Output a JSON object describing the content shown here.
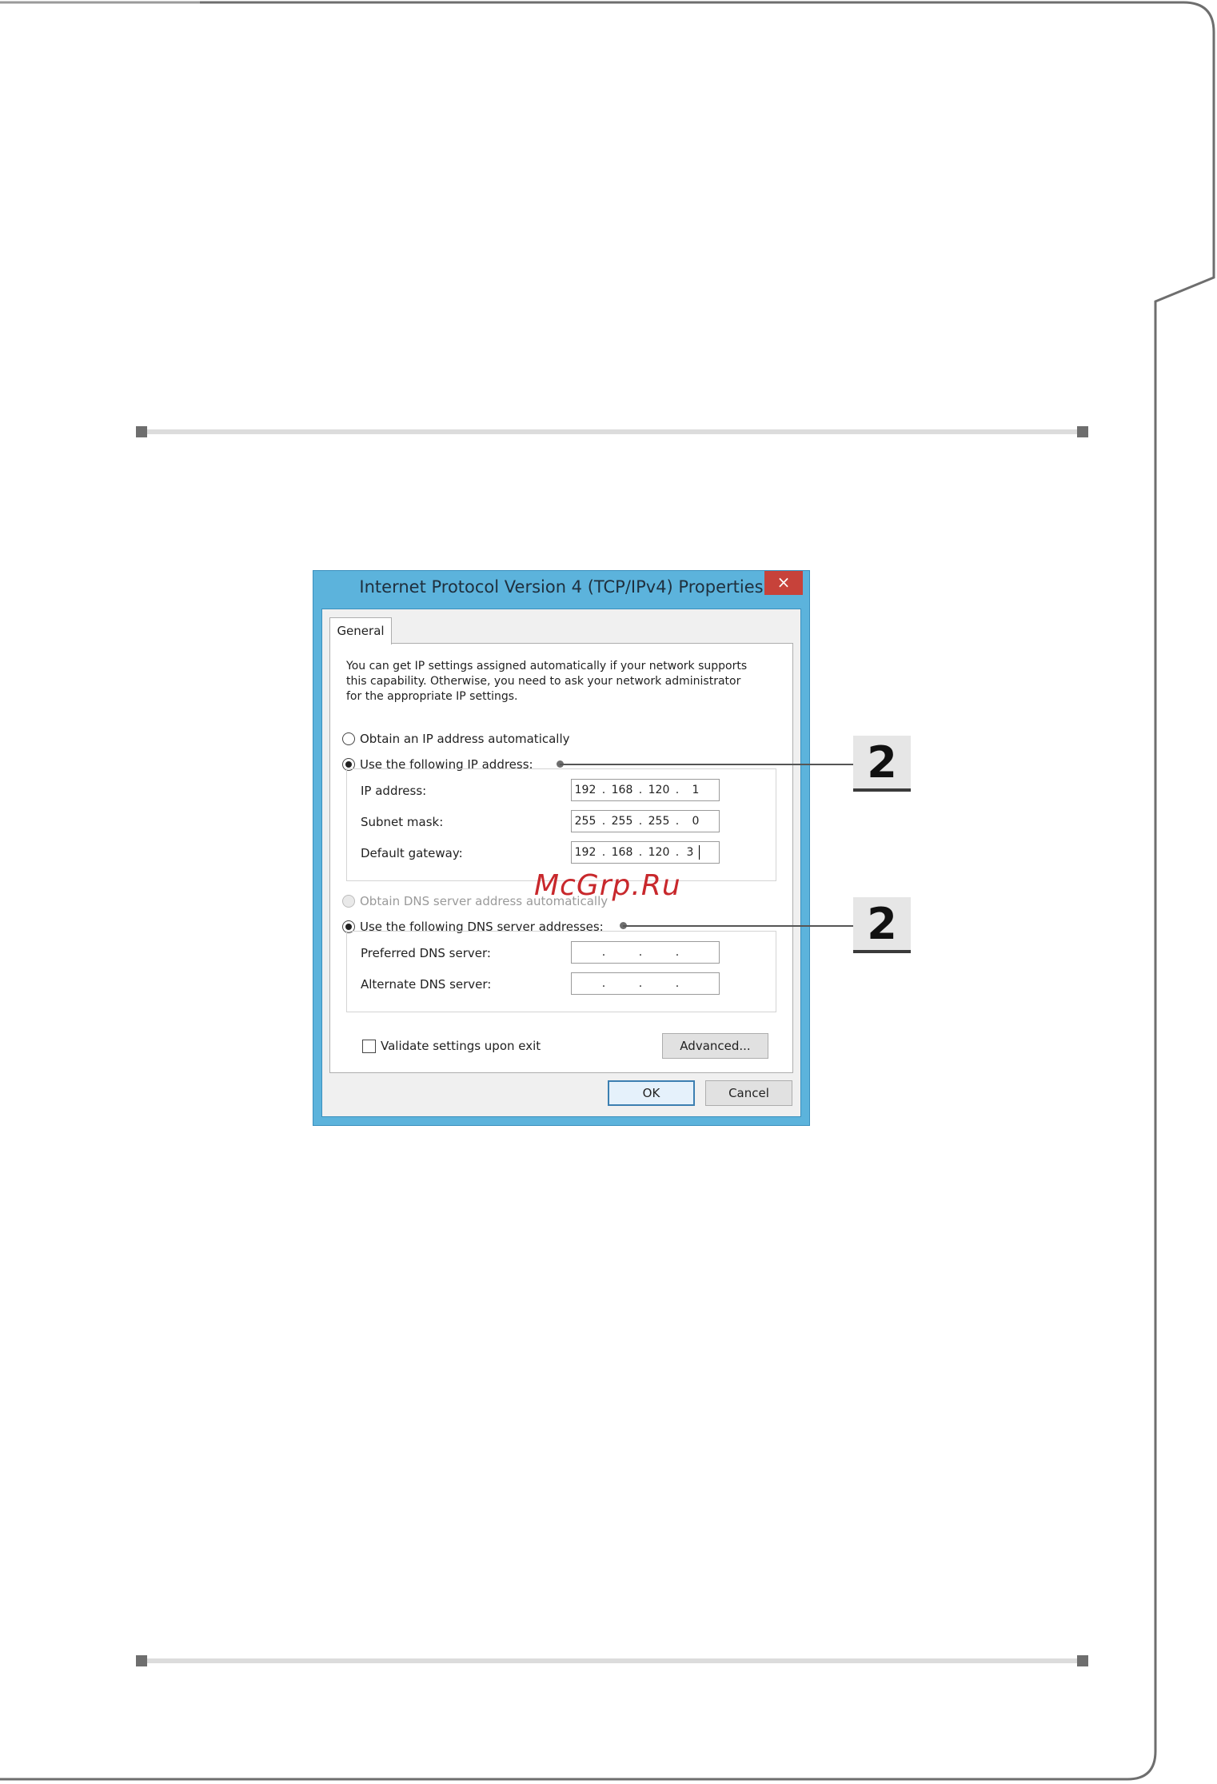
{
  "dialog": {
    "title": "Internet Protocol Version 4 (TCP/IPv4) Properties",
    "close_glyph": "×",
    "tab_label": "General",
    "description_lines": [
      "You can get IP settings assigned automatically if your network supports",
      "this capability. Otherwise, you need to ask your network administrator",
      "for the appropriate IP settings."
    ],
    "ip_auto_label": "Obtain an IP address automatically",
    "ip_manual_label": "Use the following IP address:",
    "fields": [
      {
        "label": "IP address:",
        "octets": [
          "192",
          "168",
          "120",
          "1"
        ]
      },
      {
        "label": "Subnet mask:",
        "octets": [
          "255",
          "255",
          "255",
          "0"
        ]
      },
      {
        "label": "Default gateway:",
        "octets": [
          "192",
          "168",
          "120",
          "3"
        ]
      }
    ],
    "dns_auto_label": "Obtain DNS server address automatically",
    "dns_manual_label": "Use the following DNS server addresses:",
    "dns_fields": [
      {
        "label": "Preferred DNS server:"
      },
      {
        "label": "Alternate DNS server:"
      }
    ],
    "octet_separator": ".",
    "validate_label": "Validate settings upon exit",
    "advanced_label": "Advanced...",
    "ok_label": "OK",
    "cancel_label": "Cancel"
  },
  "callouts": [
    "2",
    "2"
  ],
  "watermark": "McGrp.Ru",
  "colors": {
    "title_bar": "#5cb3dc",
    "close_button": "#c7423a",
    "watermark": "#c8282c"
  }
}
